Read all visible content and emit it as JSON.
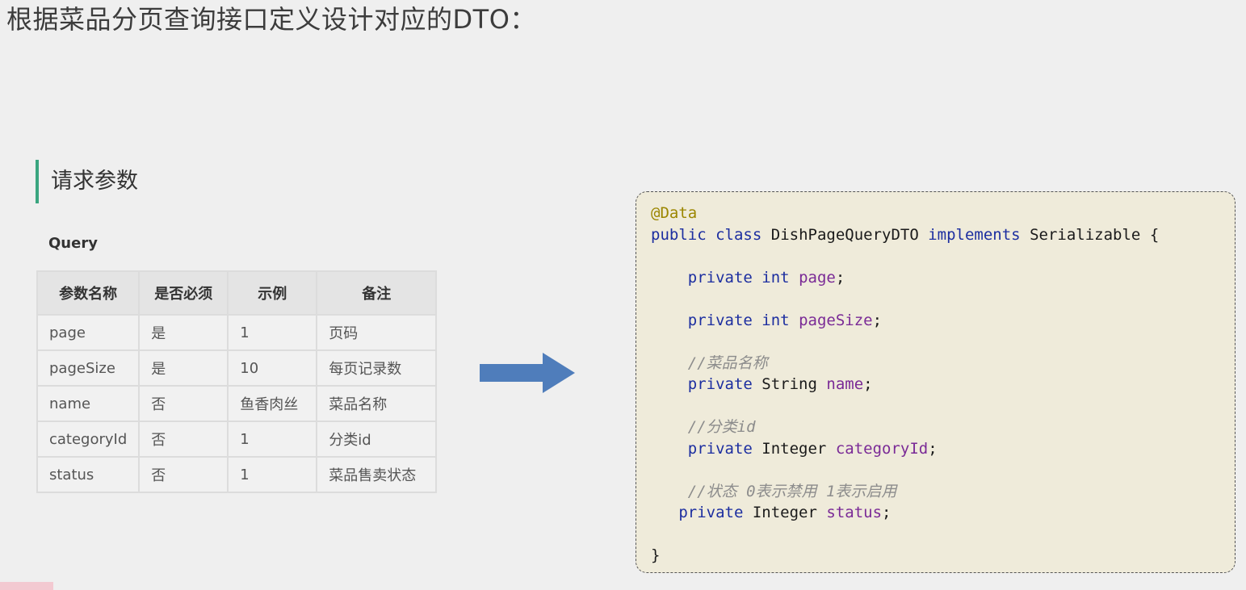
{
  "title": "根据菜品分页查询接口定义设计对应的DTO：",
  "section_heading": "请求参数",
  "query_label": "Query",
  "table": {
    "headers": [
      "参数名称",
      "是否必须",
      "示例",
      "备注"
    ],
    "rows": [
      [
        "page",
        "是",
        "1",
        "页码"
      ],
      [
        "pageSize",
        "是",
        "10",
        "每页记录数"
      ],
      [
        "name",
        "否",
        "鱼香肉丝",
        "菜品名称"
      ],
      [
        "categoryId",
        "否",
        "1",
        "分类id"
      ],
      [
        "status",
        "否",
        "1",
        "菜品售卖状态"
      ]
    ]
  },
  "arrow": {
    "icon": "right-arrow-icon",
    "color": "#4f7dbb"
  },
  "code": {
    "annotation": "@Data",
    "kw_public": "public",
    "kw_class": "class",
    "class_name": "DishPageQueryDTO",
    "kw_implements": "implements",
    "interface_name": "Serializable",
    "open_brace": "{",
    "close_brace": "}",
    "kw_private": "private",
    "type_int": "int",
    "type_string": "String",
    "type_integer": "Integer",
    "field_page": "page",
    "field_pagesize": "pageSize",
    "field_name": "name",
    "field_categoryid": "categoryId",
    "field_status": "status",
    "semicolon": ";",
    "comment_name": "//菜品名称",
    "comment_category": "//分类id",
    "comment_status": "//状态 0表示禁用 1表示启用"
  },
  "colors": {
    "accent_bar": "#3aa57f",
    "code_background": "#efebda",
    "keyword": "#1c2ea0",
    "annotation": "#9b8600",
    "field": "#7a2a96",
    "comment": "#8c8c8c"
  }
}
